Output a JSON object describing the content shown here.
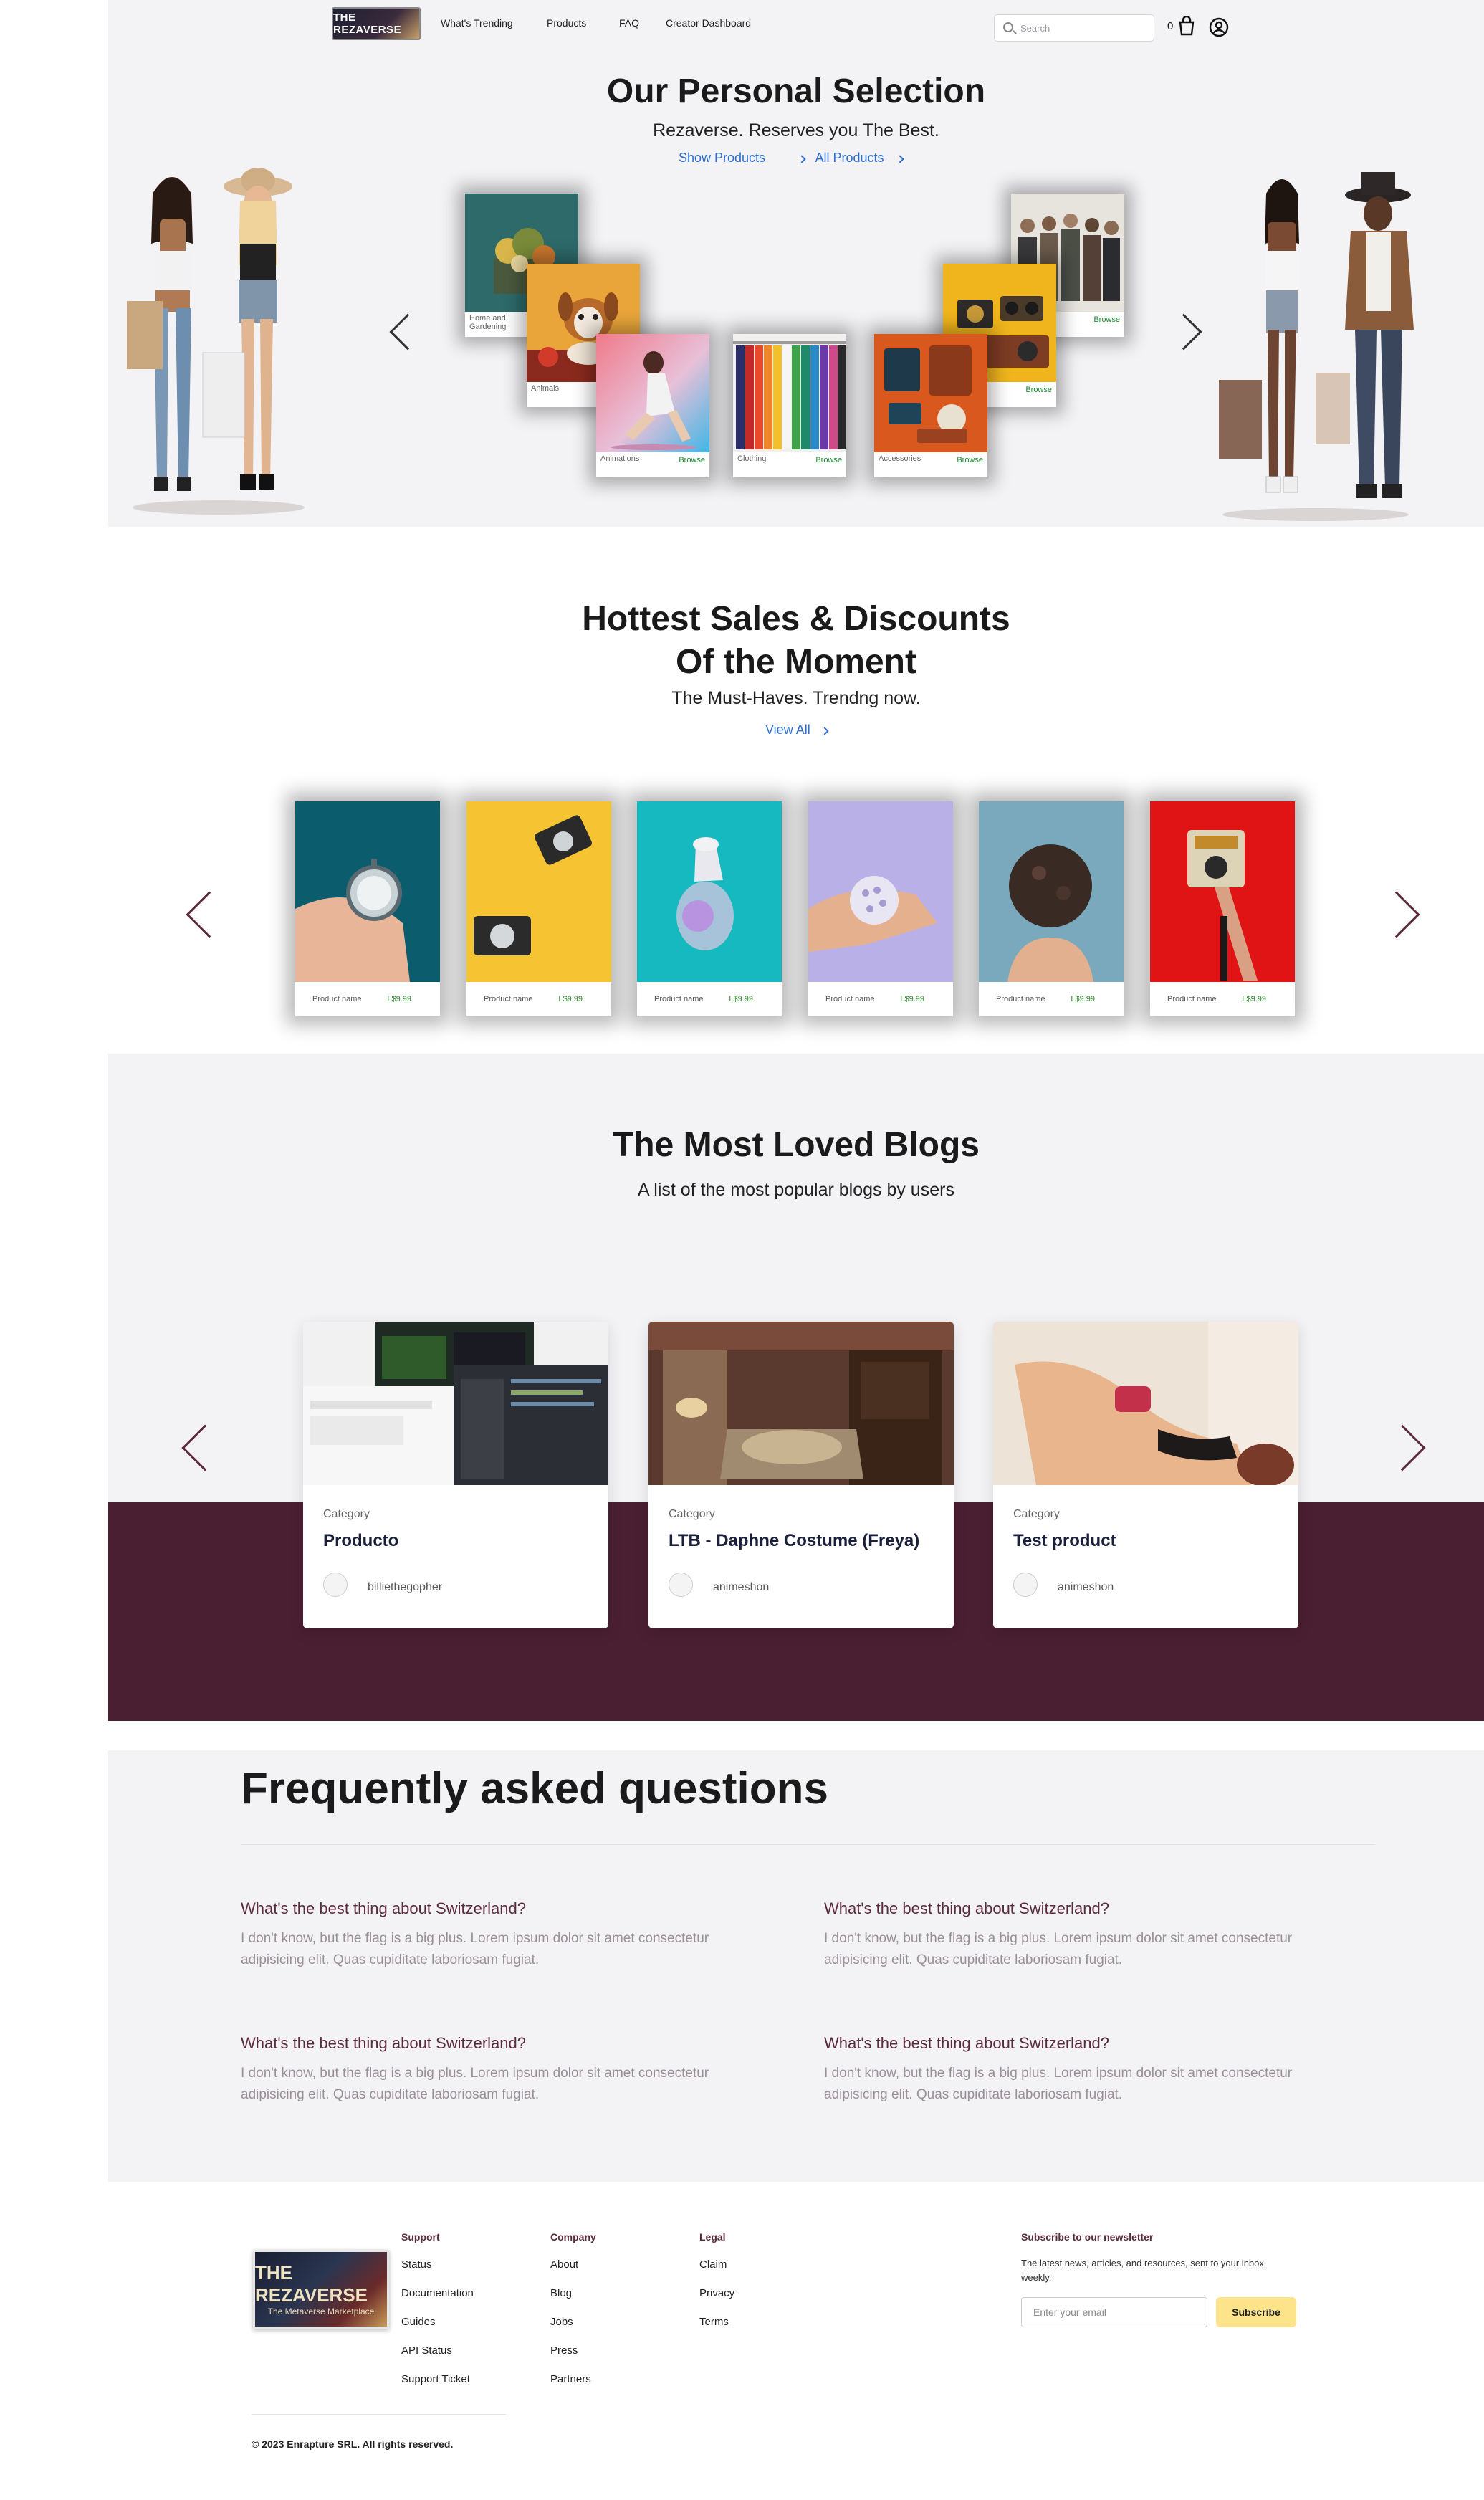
{
  "header": {
    "logo_text": "THE REZAVERSE",
    "nav": [
      "What's Trending",
      "Products",
      "FAQ",
      "Creator Dashboard"
    ],
    "search_placeholder": "Search",
    "cart_count": "0"
  },
  "hero": {
    "title": "Our Personal Selection",
    "subtitle": "Rezaverse. Reserves you The Best.",
    "show_products": "Show  Products",
    "all_products": "All Products",
    "categories": [
      {
        "name": "Home and Gardening",
        "browse": ""
      },
      {
        "name": "Animals",
        "browse": ""
      },
      {
        "name": "Animations",
        "browse": "Browse"
      },
      {
        "name": "Clothing",
        "browse": "Browse"
      },
      {
        "name": "Accessories",
        "browse": "Browse"
      },
      {
        "name": "",
        "browse": "Browse"
      },
      {
        "name": "",
        "browse": "Browse"
      }
    ]
  },
  "sales": {
    "title_line1": "Hottest Sales & Discounts",
    "title_line2": "Of the Moment",
    "subtitle": "The Must-Haves. Trendng now.",
    "view_all": "View All",
    "products": [
      {
        "name": "Product name",
        "price": "L$9.99"
      },
      {
        "name": "Product name",
        "price": "L$9.99"
      },
      {
        "name": "Product name",
        "price": "L$9.99"
      },
      {
        "name": "Product name",
        "price": "L$9.99"
      },
      {
        "name": "Product name",
        "price": "L$9.99"
      },
      {
        "name": "Product name",
        "price": "L$9.99"
      }
    ]
  },
  "blogs": {
    "title": "The Most Loved Blogs",
    "subtitle": "A list of the most popular blogs by users",
    "items": [
      {
        "category": "Category",
        "title": "Producto",
        "author": "billiethegopher"
      },
      {
        "category": "Category",
        "title": "LTB - Daphne Costume (Freya)",
        "author": "animeshon"
      },
      {
        "category": "Category",
        "title": "Test product",
        "author": "animeshon"
      }
    ]
  },
  "faq": {
    "title": "Frequently asked questions",
    "items": [
      {
        "q": "What's the best thing about Switzerland?",
        "a": "I don't know, but the flag is a big plus. Lorem ipsum dolor sit amet consectetur adipisicing elit. Quas cupiditate laboriosam fugiat."
      },
      {
        "q": "What's the best thing about Switzerland?",
        "a": "I don't know, but the flag is a big plus. Lorem ipsum dolor sit amet consectetur adipisicing elit. Quas cupiditate laboriosam fugiat."
      },
      {
        "q": "What's the best thing about Switzerland?",
        "a": "I don't know, but the flag is a big plus. Lorem ipsum dolor sit amet consectetur adipisicing elit. Quas cupiditate laboriosam fugiat."
      },
      {
        "q": "What's the best thing about Switzerland?",
        "a": "I don't know, but the flag is a big plus. Lorem ipsum dolor sit amet consectetur adipisicing elit. Quas cupiditate laboriosam fugiat."
      }
    ]
  },
  "footer": {
    "logo_title": "THE REZAVERSE",
    "logo_subtitle": "The Metaverse Marketplace",
    "support": {
      "head": "Support",
      "links": [
        "Status",
        "Documentation",
        "Guides",
        "API Status",
        "Support Ticket"
      ]
    },
    "company": {
      "head": "Company",
      "links": [
        "About",
        "Blog",
        "Jobs",
        "Press",
        "Partners"
      ]
    },
    "legal": {
      "head": "Legal",
      "links": [
        "Claim",
        "Privacy",
        "Terms"
      ]
    },
    "newsletter": {
      "head": "Subscribe to our newsletter",
      "text": "The latest news, articles, and resources, sent to your inbox weekly.",
      "placeholder": "Enter your email",
      "button": "Subscribe"
    },
    "copyright": "© 2023 Enrapture SRL.  All rights reserved."
  },
  "colors": {
    "accent": "#5b2a3c",
    "link": "#2f6fd1",
    "price": "#2e8a2a",
    "subscribe": "#fde38a",
    "panel": "#4a1f31"
  }
}
